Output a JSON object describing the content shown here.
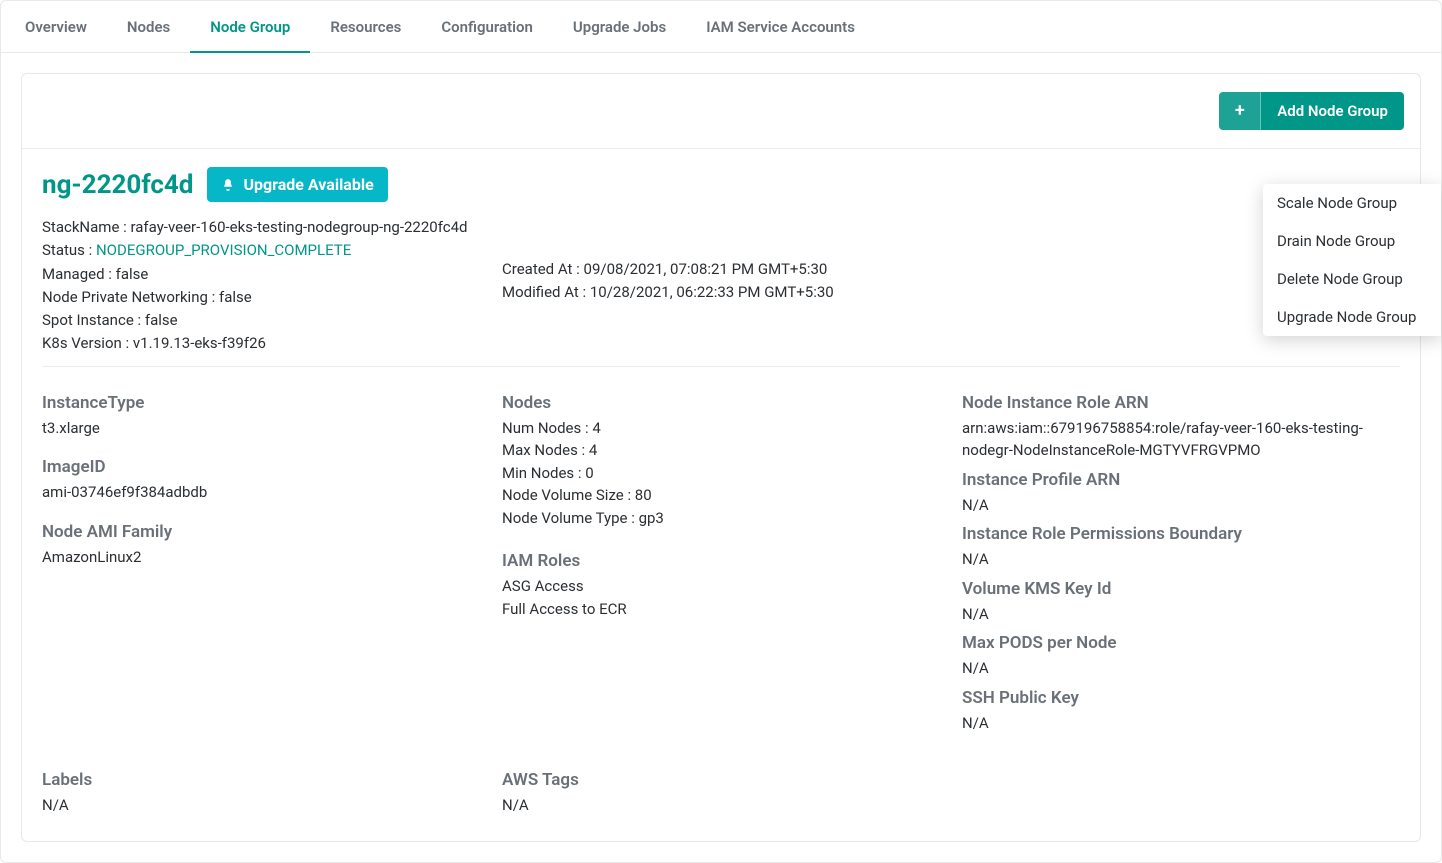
{
  "tabs": {
    "items": [
      {
        "label": "Overview"
      },
      {
        "label": "Nodes"
      },
      {
        "label": "Node Group"
      },
      {
        "label": "Resources"
      },
      {
        "label": "Configuration"
      },
      {
        "label": "Upgrade Jobs"
      },
      {
        "label": "IAM Service Accounts"
      }
    ],
    "activeIndex": 2
  },
  "toolbar": {
    "add_label": "Add Node Group"
  },
  "nodegroup": {
    "name": "ng-2220fc4d",
    "upgrade_chip": "Upgrade Available",
    "meta": {
      "stackname_label": "StackName : ",
      "stackname": "rafay-veer-160-eks-testing-nodegroup-ng-2220fc4d",
      "status_label": "Status : ",
      "status": "NODEGROUP_PROVISION_COMPLETE",
      "managed_label": "Managed : ",
      "managed": "false",
      "npn_label": "Node Private Networking : ",
      "npn": "false",
      "spot_label": "Spot Instance : ",
      "spot": "false",
      "k8s_label": "K8s Version : ",
      "k8s": "v1.19.13-eks-f39f26",
      "created_label": "Created At :",
      "created": "09/08/2021, 07:08:21 PM GMT+5:30",
      "modified_label": "Modified At :",
      "modified": "10/28/2021, 06:22:33 PM GMT+5:30"
    },
    "col1": {
      "instance_type_h": "InstanceType",
      "instance_type": "t3.xlarge",
      "image_id_h": "ImageID",
      "image_id": "ami-03746ef9f384adbdb",
      "ami_family_h": "Node AMI Family",
      "ami_family": "AmazonLinux2"
    },
    "col2": {
      "nodes_h": "Nodes",
      "num_nodes": "Num Nodes : 4",
      "max_nodes": "Max Nodes : 4",
      "min_nodes": "Min Nodes : 0",
      "vol_size": "Node Volume Size :  80",
      "vol_type": "Node Volume Type :  gp3",
      "iam_h": "IAM Roles",
      "iam_1": "ASG Access",
      "iam_2": "Full Access to ECR"
    },
    "col3": {
      "role_arn_h": "Node Instance Role ARN",
      "role_arn": "arn:aws:iam::679196758854:role/rafay-veer-160-eks-testing-nodegr-NodeInstanceRole-MGTYVFRGVPMO",
      "profile_arn_h": "Instance Profile ARN",
      "profile_arn": "N/A",
      "perm_boundary_h": "Instance Role Permissions Boundary",
      "perm_boundary": "N/A",
      "kms_h": "Volume KMS Key Id",
      "kms": "N/A",
      "max_pods_h": "Max PODS per Node",
      "max_pods": "N/A",
      "ssh_h": "SSH Public Key",
      "ssh": "N/A"
    },
    "bottom": {
      "labels_h": "Labels",
      "labels_v": "N/A",
      "tags_h": "AWS Tags",
      "tags_v": "N/A"
    }
  },
  "action_menu": {
    "items": [
      "Scale Node Group",
      "Drain Node Group",
      "Delete Node Group",
      "Upgrade Node Group"
    ]
  }
}
